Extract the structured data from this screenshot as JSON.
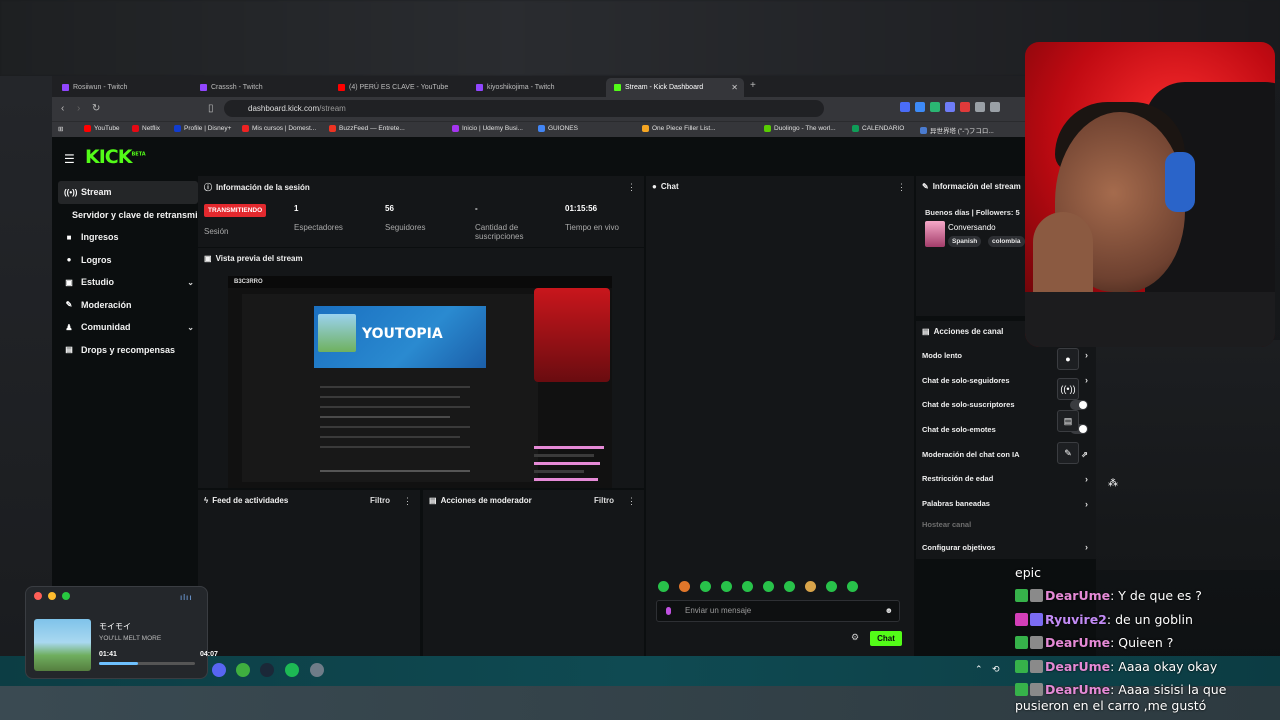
{
  "tabs": [
    {
      "label": "Rosiiwun - Twitch",
      "color": "#9146ff"
    },
    {
      "label": "Crasssh - Twitch",
      "color": "#9146ff"
    },
    {
      "label": "(4) PERÚ ES CLAVE - YouTube",
      "color": "#ff0000"
    },
    {
      "label": "kiyoshikojima - Twitch",
      "color": "#9146ff"
    },
    {
      "label": "Stream - Kick Dashboard",
      "color": "#53fc18",
      "active": true
    }
  ],
  "new_tab": "+",
  "address": {
    "host": "dashboard.kick.com",
    "path": "/stream"
  },
  "bookmarks": [
    "YouTube",
    "Netflix",
    "Profile | Disney+",
    "Mis cursos | Domest...",
    "BuzzFeed — Entrete...",
    "Inicio | Udemy Busi...",
    "GUIONES",
    "One Piece Filler List...",
    "Duolingo - The worl...",
    "CALENDARIO",
    "异世界塔 (\"-\")フコロ..."
  ],
  "kick": {
    "logo": "KICK",
    "beta": "BETA",
    "sidebar": [
      {
        "label": "Stream",
        "icon": "((•))",
        "active": true
      },
      {
        "label": "Servidor y clave de retransmisión",
        "sub": true
      },
      {
        "label": "Ingresos",
        "icon": "■"
      },
      {
        "label": "Logros",
        "icon": "●"
      },
      {
        "label": "Estudio",
        "icon": "▣",
        "chevron": true
      },
      {
        "label": "Moderación",
        "icon": "✎"
      },
      {
        "label": "Comunidad",
        "icon": "♟",
        "chevron": true
      },
      {
        "label": "Drops y recompensas",
        "icon": "▤"
      }
    ],
    "session": {
      "title": "Información de la sesión",
      "status": "TRANSMITIENDO",
      "status_label": "Sesión",
      "stats": [
        {
          "value": "1",
          "label": "Espectadores"
        },
        {
          "value": "56",
          "label": "Seguidores"
        },
        {
          "value": "-",
          "label": "Cantidad de suscripciones"
        },
        {
          "value": "01:15:56",
          "label": "Tiempo en vivo"
        }
      ]
    },
    "preview": {
      "title": "Vista previa del stream",
      "channel": "B3C3RRO",
      "inner_title": "YOUTOPIA"
    },
    "feed": {
      "title": "Feed de actividades",
      "filter": "Filtro"
    },
    "mod_actions": {
      "title": "Acciones de moderador",
      "filter": "Filtro"
    },
    "chat": {
      "title": "Chat",
      "placeholder": "Enviar un mensaje",
      "send": "Chat"
    },
    "stream_info": {
      "title": "Información del stream",
      "greeting": "Buenos días | Followers: 5",
      "category": "Conversando",
      "tags": [
        "Spanish",
        "colombia"
      ]
    },
    "channel_actions": {
      "title": "Acciones de canal",
      "items": [
        {
          "label": "Modo lento",
          "kind": "chevron"
        },
        {
          "label": "Chat de solo-seguidores",
          "kind": "chevron"
        },
        {
          "label": "Chat de solo-suscriptores",
          "kind": "toggle"
        },
        {
          "label": "Chat de solo-emotes",
          "kind": "toggle"
        },
        {
          "label": "Moderación del chat con IA",
          "kind": "external"
        },
        {
          "label": "Restricción de edad",
          "kind": "chevron"
        },
        {
          "label": "Palabras baneadas",
          "kind": "chevron"
        },
        {
          "label": "Hostear canal",
          "kind": "disabled"
        },
        {
          "label": "Configurar objetivos",
          "kind": "chevron"
        }
      ]
    }
  },
  "music": {
    "title": "モイモイ",
    "artist": "YOU'LL MELT MORE",
    "elapsed": "01:41",
    "total": "04:07",
    "progress": 0.41
  },
  "overlay_chat": [
    {
      "user": "",
      "message": "epic"
    },
    {
      "user": "DearUme",
      "message": "Y de que es ?",
      "color": "#e58ad6"
    },
    {
      "user": "Ryuvire2",
      "message": "de un goblin",
      "color": "#c28bf5"
    },
    {
      "user": "DearUme",
      "message": "Quieen ?",
      "color": "#e58ad6"
    },
    {
      "user": "DearUme",
      "message": "Aaaa okay okay",
      "color": "#e58ad6"
    },
    {
      "user": "DearUme",
      "message": "Aaaa sisisi la que pusieron en el carro ,me gustó",
      "color": "#e58ad6"
    }
  ]
}
